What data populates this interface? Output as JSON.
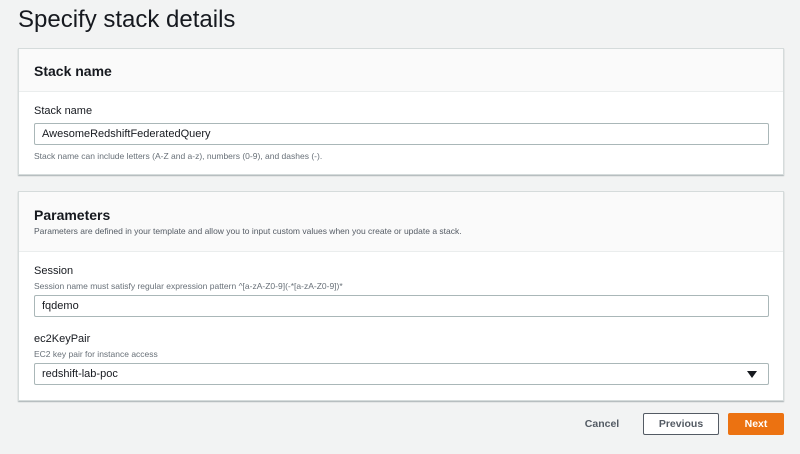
{
  "page": {
    "title": "Specify stack details"
  },
  "stack_name_panel": {
    "heading": "Stack name",
    "field_label": "Stack name",
    "field_value": "AwesomeRedshiftFederatedQuery",
    "field_hint": "Stack name can include letters (A-Z and a-z), numbers (0-9), and dashes (-)."
  },
  "parameters_panel": {
    "heading": "Parameters",
    "description": "Parameters are defined in your template and allow you to input custom values when you create or update a stack.",
    "session": {
      "label": "Session",
      "description": "Session name must satisfy regular expression pattern ^[a-zA-Z0-9](-*[a-zA-Z0-9])*",
      "value": "fqdemo"
    },
    "key_pair": {
      "label": "ec2KeyPair",
      "description": "EC2 key pair for instance access",
      "selected": "redshift-lab-poc"
    }
  },
  "actions": {
    "cancel": "Cancel",
    "previous": "Previous",
    "next": "Next"
  },
  "colors": {
    "primary_button": "#ec7211",
    "background": "#f2f3f3"
  }
}
